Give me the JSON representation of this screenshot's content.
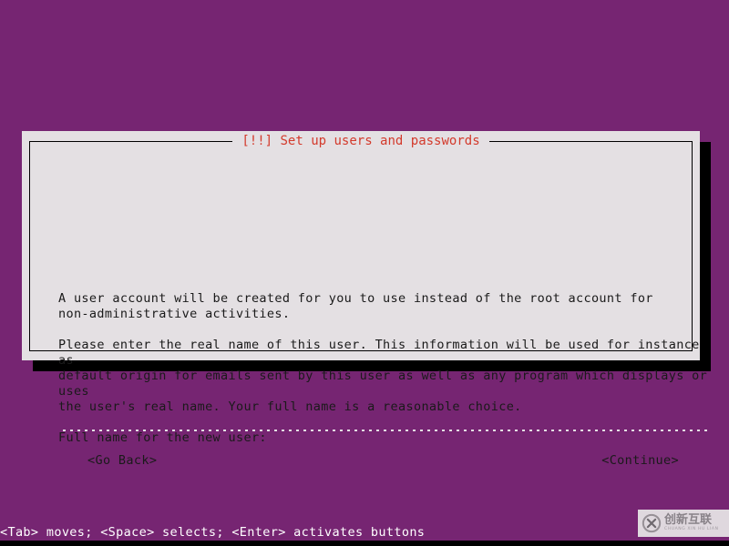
{
  "screen": {
    "background_color": "#762572",
    "text_color": "#ffffff"
  },
  "dialog": {
    "title": "[!!] Set up users and passwords",
    "title_color": "#d33a2c",
    "panel_color": "#e4e0e3",
    "border_color": "#000000",
    "paragraphs": [
      "A user account will be created for you to use instead of the root account for\nnon-administrative activities.",
      "Please enter the real name of this user. This information will be used for instance as\ndefault origin for emails sent by this user as well as any program which displays or uses\nthe user's real name. Your full name is a reasonable choice.",
      "Full name for the new user:"
    ],
    "input": {
      "value": "",
      "placeholder": "",
      "field_color": "#762572"
    },
    "buttons": {
      "go_back": "<Go Back>",
      "continue": "<Continue>"
    }
  },
  "status_bar": {
    "text": "<Tab> moves; <Space> selects; <Enter> activates buttons"
  },
  "watermark": {
    "logo_icon": "circled-x-icon",
    "chinese": "创新互联",
    "pinyin": "CHUANG XIN HU LIAN"
  }
}
